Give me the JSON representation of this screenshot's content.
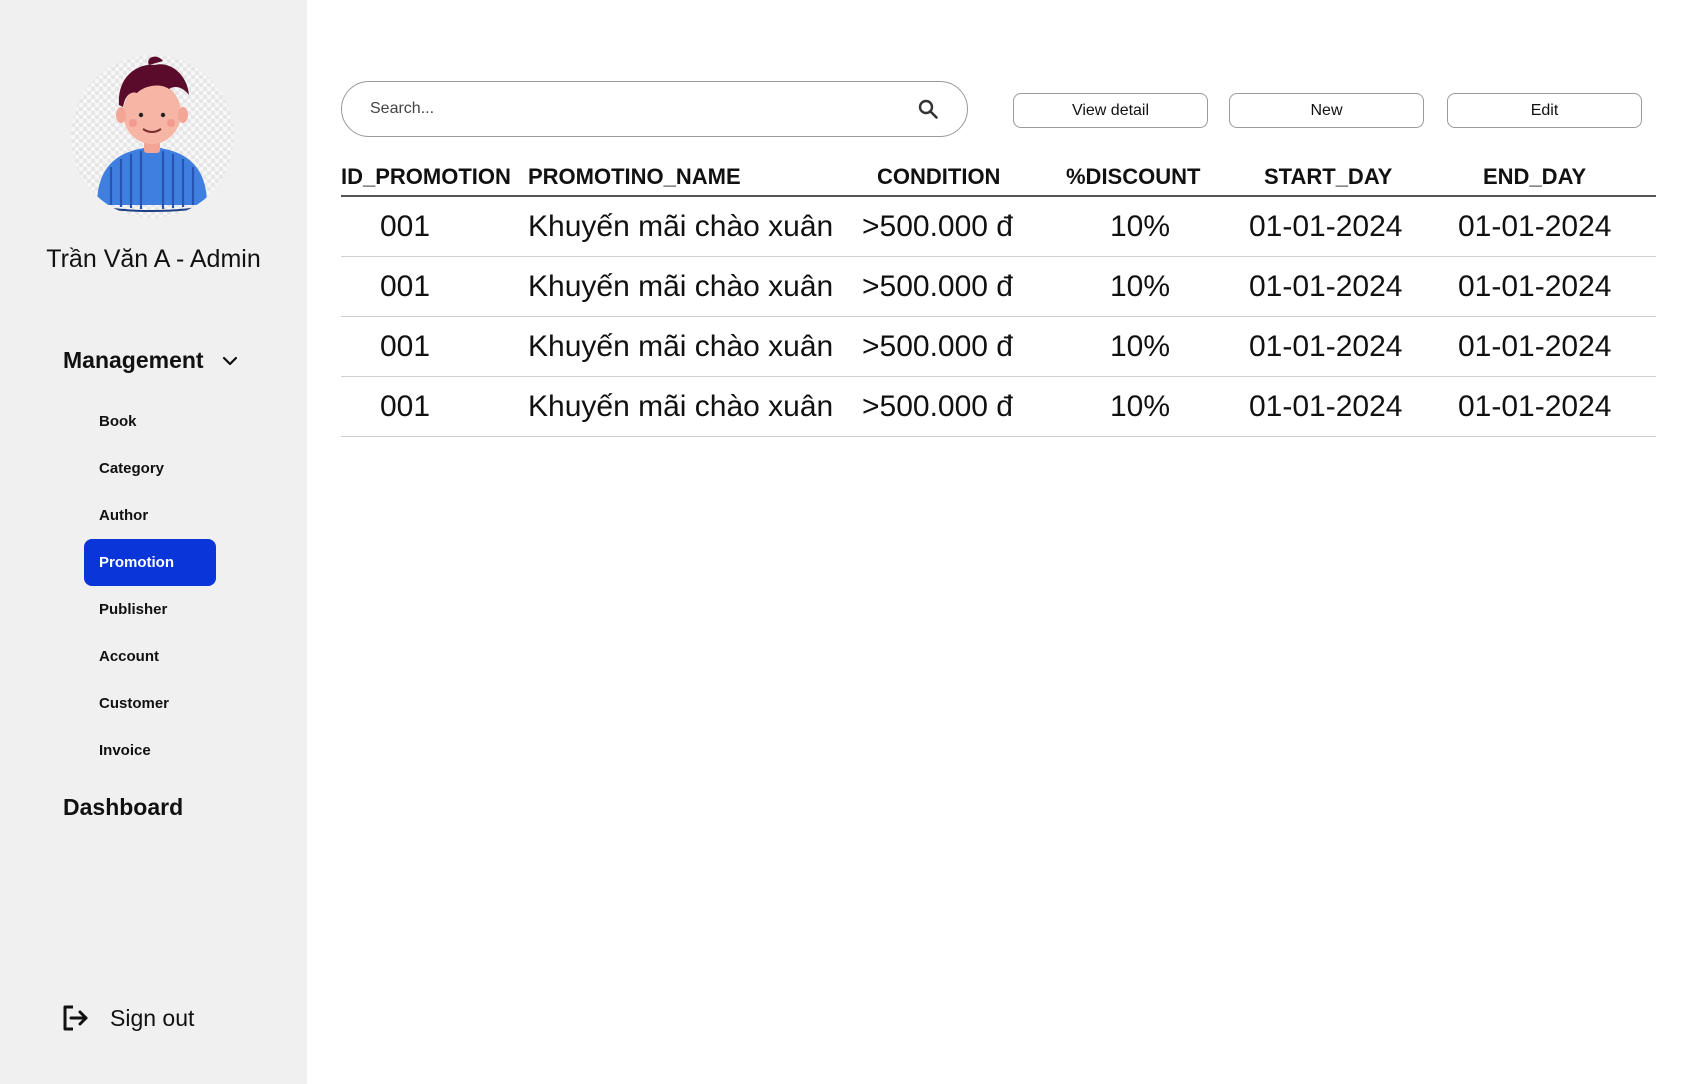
{
  "user": {
    "name": "Trần Văn A - Admin"
  },
  "sidebar": {
    "management_label": "Management",
    "items": [
      {
        "label": "Book",
        "active": false
      },
      {
        "label": "Category",
        "active": false
      },
      {
        "label": "Author",
        "active": false
      },
      {
        "label": "Promotion",
        "active": true
      },
      {
        "label": "Publisher",
        "active": false
      },
      {
        "label": "Account",
        "active": false
      },
      {
        "label": "Customer",
        "active": false
      },
      {
        "label": "Invoice",
        "active": false
      }
    ],
    "dashboard_label": "Dashboard",
    "signout_label": "Sign out"
  },
  "toolbar": {
    "search_placeholder": "Search...",
    "view_detail_label": "View detail",
    "new_label": "New",
    "edit_label": "Edit"
  },
  "table": {
    "columns": [
      "ID_PROMOTION",
      "PROMOTINO_NAME",
      "CONDITION",
      "%DISCOUNT",
      "START_DAY",
      "END_DAY"
    ],
    "rows": [
      [
        "001",
        "Khuyến mãi chào xuân",
        ">500.000 đ",
        "10%",
        "01-01-2024",
        "01-01-2024"
      ],
      [
        "001",
        "Khuyến mãi chào xuân",
        ">500.000 đ",
        "10%",
        "01-01-2024",
        "01-01-2024"
      ],
      [
        "001",
        "Khuyến mãi chào xuân",
        ">500.000 đ",
        "10%",
        "01-01-2024",
        "01-01-2024"
      ],
      [
        "001",
        "Khuyến mãi chào xuân",
        ">500.000 đ",
        "10%",
        "01-01-2024",
        "01-01-2024"
      ]
    ]
  },
  "colors": {
    "sidebar_bg": "#f0f0f0",
    "active_item": "#0a35d8",
    "border": "#9a9a9a"
  }
}
